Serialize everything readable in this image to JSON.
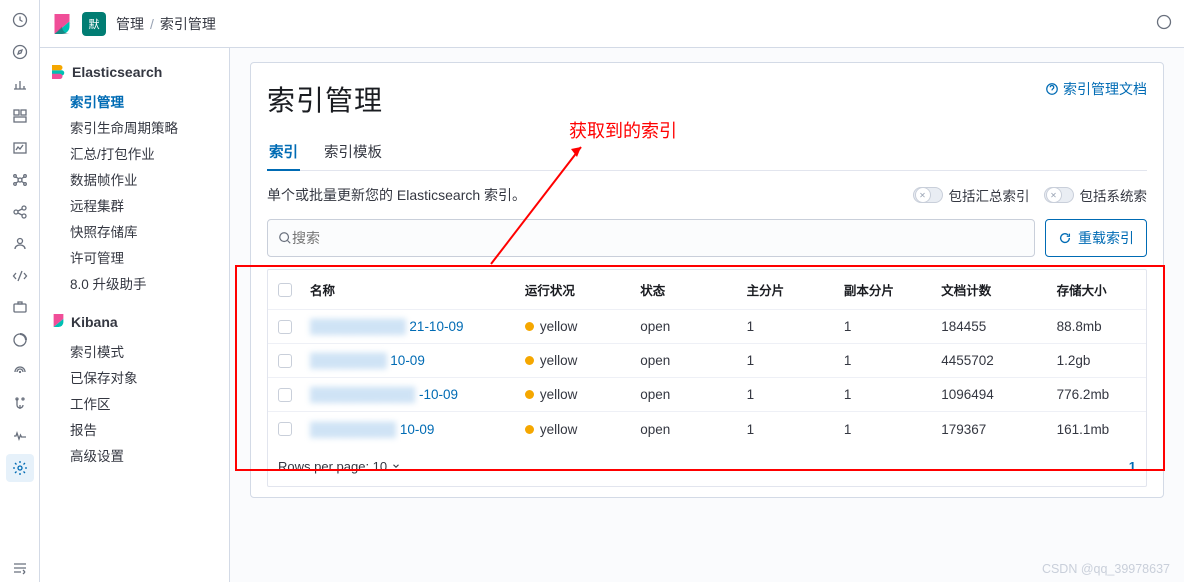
{
  "header": {
    "brand_text": "默",
    "breadcrumb_root": "管理",
    "breadcrumb_leaf": "索引管理"
  },
  "leftnav": {
    "items": [
      "clock",
      "compass",
      "chart",
      "dashboard",
      "metrics",
      "ml",
      "graph",
      "user",
      "devtools",
      "apm",
      "uptime",
      "infra",
      "logs",
      "heartbeat",
      "settings"
    ]
  },
  "sidebar": {
    "es_title": "Elasticsearch",
    "es_items": [
      "索引管理",
      "索引生命周期策略",
      "汇总/打包作业",
      "数据帧作业",
      "远程集群",
      "快照存储库",
      "许可管理",
      "8.0 升级助手"
    ],
    "kb_title": "Kibana",
    "kb_items": [
      "索引模式",
      "已保存对象",
      "工作区",
      "报告",
      "高级设置"
    ]
  },
  "page": {
    "title": "索引管理",
    "doc_link": "索引管理文档",
    "tabs": [
      "索引",
      "索引模板"
    ],
    "description": "单个或批量更新您的 Elasticsearch 索引。",
    "switch1": "包括汇总索引",
    "switch2": "包括系统索",
    "search_placeholder": "搜索",
    "reload_label": "重载索引",
    "annotation": "获取到的索引"
  },
  "table": {
    "headers": {
      "name": "名称",
      "health": "运行状况",
      "state": "状态",
      "shard": "主分片",
      "rep": "副本分片",
      "docs": "文档计数",
      "size": "存储大小"
    },
    "rows": [
      {
        "name_hidden": "██████████",
        "name_suffix": "21-10-09",
        "health": "yellow",
        "state": "open",
        "shard": "1",
        "rep": "1",
        "docs": "184455",
        "size": "88.8mb"
      },
      {
        "name_hidden": "████████",
        "name_suffix": "10-09",
        "health": "yellow",
        "state": "open",
        "shard": "1",
        "rep": "1",
        "docs": "4455702",
        "size": "1.2gb"
      },
      {
        "name_hidden": "███████████",
        "name_suffix": "-10-09",
        "health": "yellow",
        "state": "open",
        "shard": "1",
        "rep": "1",
        "docs": "1096494",
        "size": "776.2mb"
      },
      {
        "name_hidden": "█████████",
        "name_suffix": "10-09",
        "health": "yellow",
        "state": "open",
        "shard": "1",
        "rep": "1",
        "docs": "179367",
        "size": "161.1mb"
      }
    ],
    "footer_label": "Rows per page: 10",
    "page_current": "1"
  },
  "watermark": "CSDN @qq_39978637"
}
